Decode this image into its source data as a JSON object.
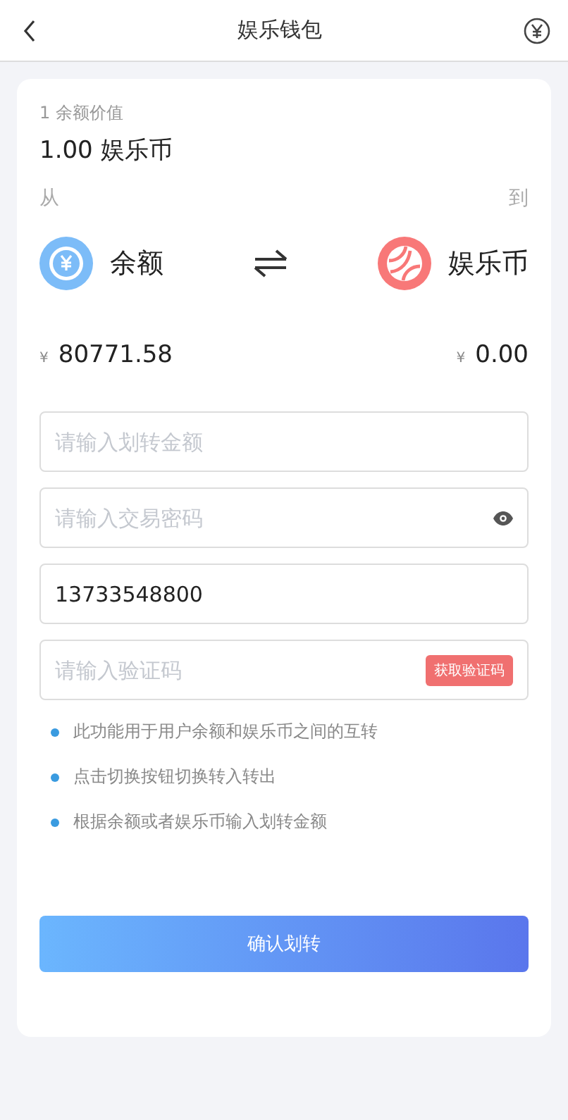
{
  "header": {
    "title": "娱乐钱包"
  },
  "rate": {
    "label": "1 余额价值",
    "value": "1.00 娱乐币"
  },
  "direction": {
    "from_label": "从",
    "to_label": "到"
  },
  "from": {
    "name": "余额",
    "symbol": "¥",
    "amount": "80771.58"
  },
  "to": {
    "name": "娱乐币",
    "symbol": "¥",
    "amount": "0.00"
  },
  "fields": [
    {
      "kind": "plain",
      "placeholder": "请输入划转金额"
    },
    {
      "kind": "password",
      "placeholder": "请输入交易密码"
    },
    {
      "kind": "plain",
      "value": "13733548800"
    },
    {
      "kind": "code",
      "placeholder": "请输入验证码",
      "button": "获取验证码"
    }
  ],
  "notes": [
    "此功能用于用户余额和娱乐币之间的互转",
    "点击切换按钮切换转入转出",
    "根据余额或者娱乐币输入划转金额"
  ],
  "submit": "确认划转"
}
